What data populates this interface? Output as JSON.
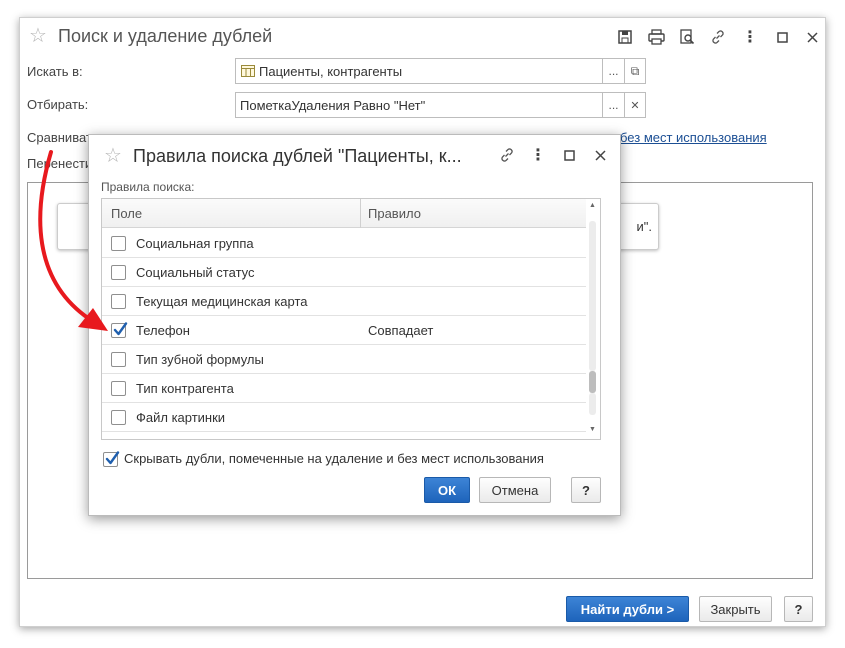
{
  "main": {
    "title": "Поиск и удаление дублей",
    "search_in": {
      "label": "Искать в:",
      "value": "Пациенты, контрагенты",
      "choose_btn": "...",
      "open_btn": "⧉"
    },
    "filter": {
      "label": "Отбирать:",
      "value": "ПометкаУдаления Равно \"Нет\"",
      "choose_btn": "...",
      "clear_btn": "✕"
    },
    "compare": {
      "label": "Сравнивать",
      "link_right": "без мест использования"
    },
    "move": {
      "label": "Перенести"
    },
    "info_tail": "и\".",
    "buttons": {
      "find": "Найти дубли >",
      "close": "Закрыть",
      "help": "?"
    }
  },
  "dialog": {
    "title": "Правила поиска дублей \"Пациенты, к...",
    "rules_label": "Правила поиска:",
    "columns": {
      "field": "Поле",
      "rule": "Правило"
    },
    "rows": [
      {
        "field": "Социальная группа",
        "rule": "",
        "checked": false
      },
      {
        "field": "Социальный статус",
        "rule": "",
        "checked": false
      },
      {
        "field": "Текущая медицинская карта",
        "rule": "",
        "checked": false
      },
      {
        "field": "Телефон",
        "rule": "Совпадает",
        "checked": true
      },
      {
        "field": "Тип зубной формулы",
        "rule": "",
        "checked": false
      },
      {
        "field": "Тип контрагента",
        "rule": "",
        "checked": false
      },
      {
        "field": "Файл картинки",
        "rule": "",
        "checked": false
      }
    ],
    "hide_dupes": {
      "label": "Скрывать дубли, помеченные на удаление и без мест использования",
      "checked": true
    },
    "buttons": {
      "ok": "ОК",
      "cancel": "Отмена",
      "help": "?"
    }
  },
  "colors": {
    "arrow": "#e8191e",
    "primary": "#1e64bb",
    "link": "#1c4f94",
    "check": "#1f5fae"
  }
}
